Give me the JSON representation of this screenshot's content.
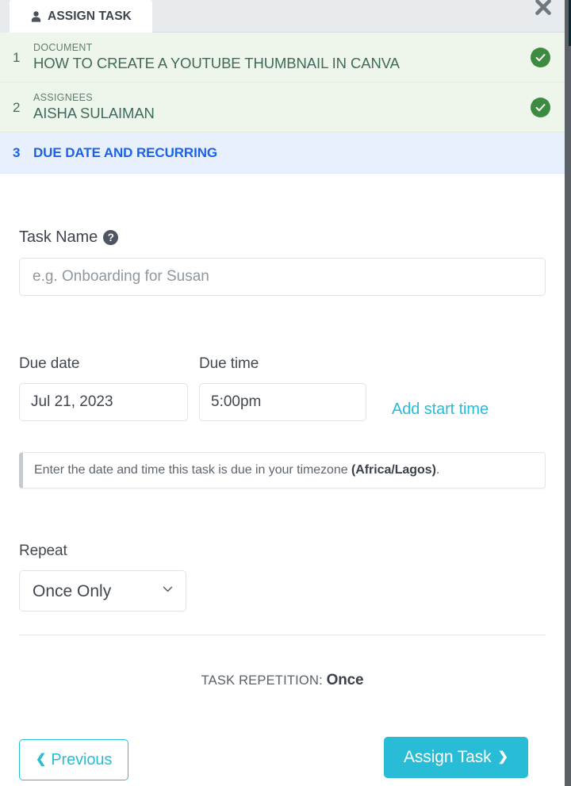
{
  "window": {
    "tab_label": "ASSIGN TASK",
    "tab_icon": "person-icon",
    "close_icon": "close-icon"
  },
  "steps": [
    {
      "number": "1",
      "kicker": "DOCUMENT",
      "value": "HOW TO CREATE A YOUTUBE THUMBNAIL IN CANVA",
      "state": "done",
      "status_icon": "check-circle-icon"
    },
    {
      "number": "2",
      "kicker": "ASSIGNEES",
      "value": "AISHA SULAIMAN",
      "state": "done",
      "status_icon": "check-circle-icon"
    },
    {
      "number": "3",
      "title": "DUE DATE AND RECURRING",
      "state": "current"
    }
  ],
  "form": {
    "task_name": {
      "label": "Task Name",
      "help_icon": "question-mark-icon",
      "value": "",
      "placeholder": "e.g. Onboarding for Susan"
    },
    "due_date": {
      "label": "Due date",
      "value": "Jul 21, 2023"
    },
    "due_time": {
      "label": "Due time",
      "value": "5:00pm"
    },
    "add_start_time_link": "Add start time",
    "hint": {
      "prefix": "Enter the date and time this task is due in your timezone ",
      "timezone": "(Africa/Lagos)",
      "suffix": "."
    },
    "repeat": {
      "label": "Repeat",
      "value": "Once Only",
      "options": [
        "Once Only"
      ],
      "chevron_icon": "chevron-down-icon"
    },
    "repetition_summary": {
      "label": "TASK REPETITION:",
      "value": "Once"
    }
  },
  "footer": {
    "previous_label": "Previous",
    "previous_icon": "chevron-left-icon",
    "assign_label": "Assign Task",
    "assign_icon": "chevron-right-icon"
  },
  "colors": {
    "accent_cyan": "#29bcd7",
    "step_current_blue": "#1b62e8",
    "step_done_green": "#3d8b40",
    "step_done_bg": "#eef5ea",
    "step_current_bg": "#e8f0fe",
    "header_bg": "#e7ebee"
  }
}
